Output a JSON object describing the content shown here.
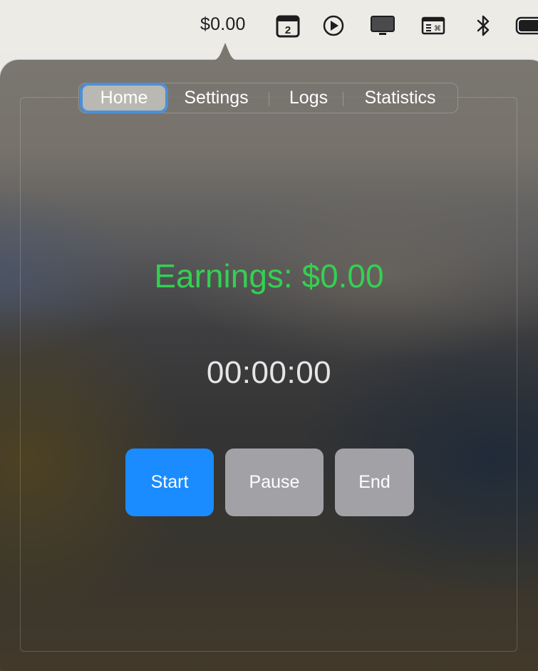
{
  "menubar": {
    "earnings_display": "$0.00",
    "calendar_day": "2",
    "icons": [
      "calendar-icon",
      "play-icon",
      "display-icon",
      "keyboard-window-icon",
      "bluetooth-icon",
      "battery-icon"
    ]
  },
  "tabs": [
    {
      "label": "Home",
      "selected": true
    },
    {
      "label": "Settings",
      "selected": false
    },
    {
      "label": "Logs",
      "selected": false
    },
    {
      "label": "Statistics",
      "selected": false
    }
  ],
  "home": {
    "earnings_text": "Earnings: $0.00",
    "timer": "00:00:00"
  },
  "buttons": {
    "start": "Start",
    "pause": "Pause",
    "end": "End"
  },
  "colors": {
    "earnings": "#33d151",
    "start_button": "#1a8cff",
    "secondary_button": "#a2a1a6",
    "focus_ring": "#4d8fd6"
  }
}
